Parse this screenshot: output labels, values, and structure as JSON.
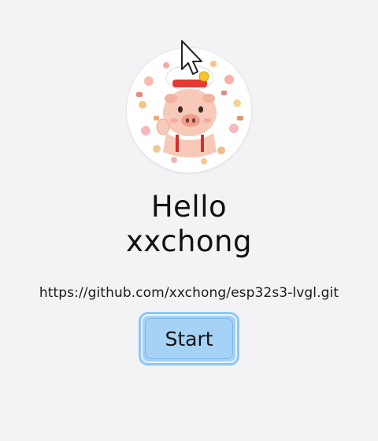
{
  "avatar": {
    "icon": "pig-character-avatar"
  },
  "greeting": {
    "line1": "Hello",
    "line2": "xxchong"
  },
  "repo": {
    "url": "https://github.com/xxchong/esp32s3-lvgl.git"
  },
  "start_button": {
    "label": "Start"
  },
  "colors": {
    "background": "#f3f3f5",
    "button_fill": "#a6d2f6",
    "button_border": "#8ec8f5",
    "text": "#111111"
  },
  "cursor": {
    "icon": "arrow-cursor-icon"
  }
}
